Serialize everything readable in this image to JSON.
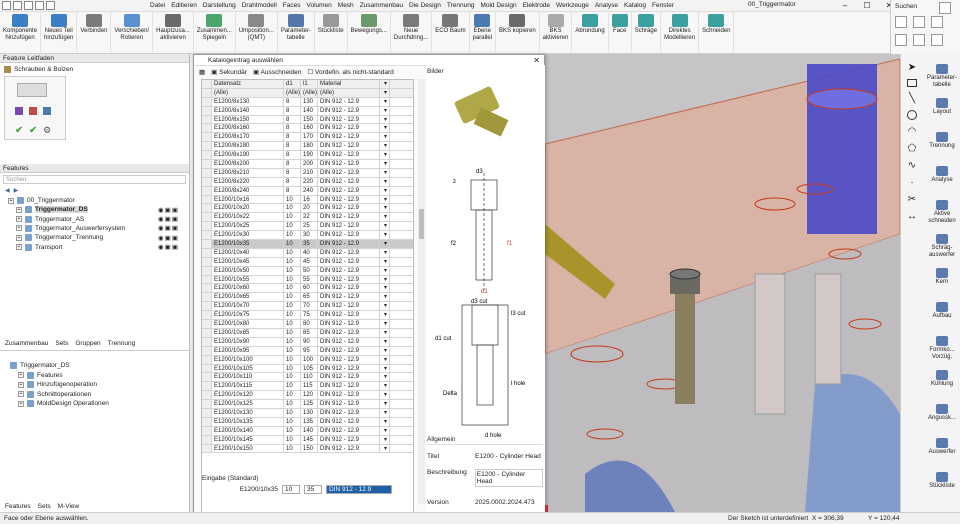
{
  "window": {
    "title": "00_Triggermator",
    "minimize": "–",
    "maximize": "☐",
    "close": "✕"
  },
  "menu": [
    "Datei",
    "Editieren",
    "Darstellung",
    "Drahtmodell",
    "Faces",
    "Volumen",
    "Mesh",
    "Zusammenbau",
    "Die Design",
    "Trennung",
    "Mold Design",
    "Elektrode",
    "Werkzeuge",
    "Analyse",
    "Katalog",
    "Fenster"
  ],
  "ribbon": [
    {
      "label": "Komponente\nhinzufügen",
      "color": "#3c7fc4"
    },
    {
      "label": "Neues Teil\nhinzufügen",
      "color": "#3c7fc4"
    },
    {
      "label": "Verbinden",
      "color": "#7a7a7a"
    },
    {
      "label": "Verschieben/\nRotieren",
      "color": "#5a8fd0"
    },
    {
      "label": "Hauptzusa...\naktivieren",
      "color": "#6a6a6a"
    },
    {
      "label": "Zusammen...\nSpiegeln",
      "color": "#4aa56a"
    },
    {
      "label": "Umposition...\n(QMT)",
      "color": "#8a8a8a"
    },
    {
      "label": "Parameter-\ntabelle",
      "color": "#5577aa"
    },
    {
      "label": "Stückliste",
      "color": "#999"
    },
    {
      "label": "Bewegungs...",
      "color": "#6a9a6a"
    },
    {
      "label": "Neue\nDurchdring...",
      "color": "#7a7a7a"
    },
    {
      "label": "ECO Baum",
      "color": "#777"
    },
    {
      "label": "Ebene\nparallel",
      "color": "#4a7ab0"
    },
    {
      "label": "BKS kopieren",
      "color": "#6a6a6a"
    },
    {
      "label": "BKS\naktivieren",
      "color": "#aaa"
    },
    {
      "label": "Abrundung",
      "color": "#3aa0a0"
    },
    {
      "label": "Face",
      "color": "#3aa0a0"
    },
    {
      "label": "Schräge",
      "color": "#3aa0a0"
    },
    {
      "label": "Direktes\nModellieren",
      "color": "#3aa0a0"
    },
    {
      "label": "Schneiden",
      "color": "#3aa0a0"
    }
  ],
  "search": {
    "label": "Suchen"
  },
  "leftpane": {
    "feature_guide": "Feature Leitfaden",
    "guide_item": "Schrauben & Bolzen",
    "features_header": "Features",
    "search_placeholder": "Suchen",
    "tree": [
      {
        "label": "00_Triggermator",
        "level": 0,
        "bold": false
      },
      {
        "label": "Triggermator_DS",
        "level": 1,
        "bold": true
      },
      {
        "label": "Triggermator_AS",
        "level": 1,
        "bold": false
      },
      {
        "label": "Triggermator_Auswerfersystem",
        "level": 1,
        "bold": false
      },
      {
        "label": "Triggermator_Trennung",
        "level": 1,
        "bold": false
      },
      {
        "label": "Transport",
        "level": 1,
        "bold": false
      }
    ],
    "tabs": [
      "Zusammenbau",
      "Sets",
      "Gruppen",
      "Trennung"
    ],
    "lower_tree": [
      {
        "label": "Triggermator_DS",
        "level": 0
      },
      {
        "label": "Features",
        "level": 1
      },
      {
        "label": "Hinzufügenoperation",
        "level": 1
      },
      {
        "label": "Schnittoperationen",
        "level": 1
      },
      {
        "label": "MoldDesign Operationen",
        "level": 1
      }
    ],
    "bottom_tabs": [
      "Features",
      "Sets",
      "M-View"
    ]
  },
  "dialog": {
    "title": "Katalogeintrag auswählen",
    "toolbar": {
      "sekundaer": "Sekundär",
      "ausschneiden": "Ausschneiden",
      "vordefin": "Vordefin. als nicht-standard"
    },
    "columns": [
      "Datensatz",
      "d1",
      "l1",
      "Material"
    ],
    "filter": [
      "(Alle)",
      "(Alle)",
      "(Alle)",
      "(Alle)"
    ],
    "rows": [
      [
        "E1200/8x130",
        "8",
        "130",
        "DIN 912 - 12.9"
      ],
      [
        "E1200/8x140",
        "8",
        "140",
        "DIN 912 - 12.9"
      ],
      [
        "E1200/8x150",
        "8",
        "150",
        "DIN 912 - 12.9"
      ],
      [
        "E1200/8x160",
        "8",
        "160",
        "DIN 912 - 12.9"
      ],
      [
        "E1200/8x170",
        "8",
        "170",
        "DIN 912 - 12.9"
      ],
      [
        "E1200/8x180",
        "8",
        "180",
        "DIN 912 - 12.9"
      ],
      [
        "E1200/8x190",
        "8",
        "190",
        "DIN 912 - 12.9"
      ],
      [
        "E1200/8x200",
        "8",
        "200",
        "DIN 912 - 12.9"
      ],
      [
        "E1200/8x210",
        "8",
        "210",
        "DIN 912 - 12.9"
      ],
      [
        "E1200/8x220",
        "8",
        "220",
        "DIN 912 - 12.9"
      ],
      [
        "E1200/8x240",
        "8",
        "240",
        "DIN 912 - 12.9"
      ],
      [
        "E1200/10x16",
        "10",
        "16",
        "DIN 912 - 12.9"
      ],
      [
        "E1200/10x20",
        "10",
        "20",
        "DIN 912 - 12.9"
      ],
      [
        "E1200/10x22",
        "10",
        "22",
        "DIN 912 - 12.9"
      ],
      [
        "E1200/10x25",
        "10",
        "25",
        "DIN 912 - 12.9"
      ],
      [
        "E1200/10x30",
        "10",
        "30",
        "DIN 912 - 12.9"
      ],
      [
        "E1200/10x35",
        "10",
        "35",
        "DIN 912 - 12.9"
      ],
      [
        "E1200/10x40",
        "10",
        "40",
        "DIN 912 - 12.9"
      ],
      [
        "E1200/10x45",
        "10",
        "45",
        "DIN 912 - 12.9"
      ],
      [
        "E1200/10x50",
        "10",
        "50",
        "DIN 912 - 12.9"
      ],
      [
        "E1200/10x55",
        "10",
        "55",
        "DIN 912 - 12.9"
      ],
      [
        "E1200/10x60",
        "10",
        "60",
        "DIN 912 - 12.9"
      ],
      [
        "E1200/10x65",
        "10",
        "65",
        "DIN 912 - 12.9"
      ],
      [
        "E1200/10x70",
        "10",
        "70",
        "DIN 912 - 12.9"
      ],
      [
        "E1200/10x75",
        "10",
        "75",
        "DIN 912 - 12.9"
      ],
      [
        "E1200/10x80",
        "10",
        "80",
        "DIN 912 - 12.9"
      ],
      [
        "E1200/10x85",
        "10",
        "85",
        "DIN 912 - 12.9"
      ],
      [
        "E1200/10x90",
        "10",
        "90",
        "DIN 912 - 12.9"
      ],
      [
        "E1200/10x95",
        "10",
        "95",
        "DIN 912 - 12.9"
      ],
      [
        "E1200/10x100",
        "10",
        "100",
        "DIN 912 - 12.9"
      ],
      [
        "E1200/10x105",
        "10",
        "105",
        "DIN 912 - 12.9"
      ],
      [
        "E1200/10x110",
        "10",
        "110",
        "DIN 912 - 12.9"
      ],
      [
        "E1200/10x115",
        "10",
        "115",
        "DIN 912 - 12.9"
      ],
      [
        "E1200/10x120",
        "10",
        "120",
        "DIN 912 - 12.9"
      ],
      [
        "E1200/10x125",
        "10",
        "125",
        "DIN 912 - 12.9"
      ],
      [
        "E1200/10x130",
        "10",
        "130",
        "DIN 912 - 12.9"
      ],
      [
        "E1200/10x135",
        "10",
        "135",
        "DIN 912 - 12.9"
      ],
      [
        "E1200/10x140",
        "10",
        "140",
        "DIN 912 - 12.9"
      ],
      [
        "E1200/10x145",
        "10",
        "145",
        "DIN 912 - 12.9"
      ],
      [
        "E1200/10x150",
        "10",
        "150",
        "DIN 912 - 12.9"
      ]
    ],
    "selected_row": 16,
    "eingabe_label": "Eingabe (Standard)",
    "eingabe": {
      "record": "E1200/10x35",
      "d1": "10",
      "l1": "35",
      "material": "DIN 912 - 12.9"
    },
    "bilder_label": "Bilder",
    "drawing_labels": {
      "d1": "d1",
      "f2": "f2",
      "f1": "f1",
      "d3cut": "d3 cut",
      "l3cut": "l3 cut",
      "d1cut": "d1 cut",
      "delta": "Delta",
      "lhole": "l hole",
      "dhole": "d hole",
      "d3": "d3",
      "z": "z"
    },
    "props": {
      "section": "Allgemein",
      "titel_label": "Titel",
      "titel_value": "E1200 - Cylinder Head",
      "besch_label": "Beschreibung",
      "besch_value": "E1200 - Cylinder Head",
      "version_label": "Version",
      "version_value": "2025.0002.2024.473"
    }
  },
  "right_tools": [
    "Parameter-\ntabelle",
    "Layout",
    "Trennung",
    "Analyse",
    "Aktive\nschneiden",
    "Schräg-\nauswerfer",
    "Kern",
    "Aufbau",
    "Formko...\nVorzüg.",
    "Kühlung",
    "Angussk...",
    "Auswerfer",
    "Stückliste"
  ],
  "status": {
    "left": "Face oder Ebene auswählen.",
    "sketch": "Der Sketch ist unterdefiniert",
    "x": "X = 306,39",
    "y": "Y = 120,44"
  },
  "colors": {
    "accent": "#1f5fa8",
    "selection": "#c9c9c9",
    "viewport_bg": "#c8c8c8",
    "plate": "#d8b6a8",
    "cylinder": "#4a49c8",
    "screw": "#8a8060"
  }
}
